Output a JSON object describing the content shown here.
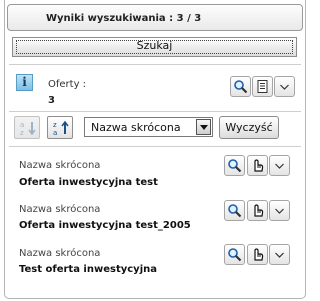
{
  "header": {
    "title": "Wyniki wyszukiwania : 3 / 3"
  },
  "search_button": {
    "label": "Szukaj"
  },
  "summary": {
    "info_icon_glyph": "i",
    "offers_label": "Oferty :",
    "offers_count": "3",
    "actions": [
      "search-icon",
      "document-list-icon",
      "chevron-down-icon"
    ]
  },
  "sort_bar": {
    "sort_ascending_icon": "sort-ascending-icon",
    "sort_descending_icon": "sort-descending-icon",
    "sort_field_selected": "Nazwa skrócona",
    "clear_label": "Wyczyść"
  },
  "results": [
    {
      "label": "Nazwa skrócona",
      "title": "Oferta inwestycyjna test"
    },
    {
      "label": "Nazwa skrócona",
      "title": "Oferta inwestycyjna test_2005"
    },
    {
      "label": "Nazwa skrócona",
      "title": "Test oferta inwestycyjna"
    }
  ],
  "colors": {
    "info_icon_bg": "#7cc0e6",
    "border": "#b4b4b4"
  }
}
